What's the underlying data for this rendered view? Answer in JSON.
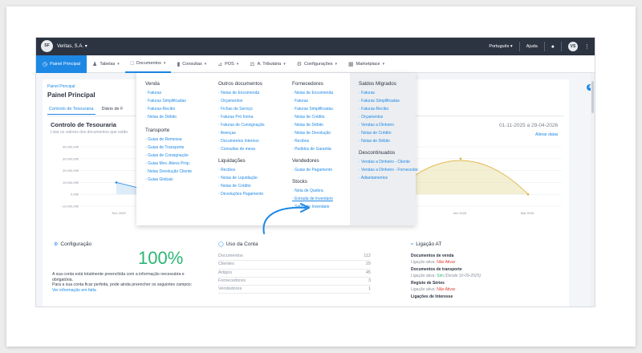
{
  "topbar": {
    "logo_text": "SF",
    "company": "Veritas, S.A.",
    "language": "Português",
    "help": "Ajuda",
    "avatar_text": "VS"
  },
  "navbar": {
    "items": [
      {
        "label": "Painel Principal",
        "icon": "clock-icon"
      },
      {
        "label": "Tabelas",
        "icon": "users-icon"
      },
      {
        "label": "Documentos",
        "icon": "document-icon"
      },
      {
        "label": "Consultas",
        "icon": "bar-chart-icon"
      },
      {
        "label": "POS",
        "icon": "pos-icon"
      },
      {
        "label": "A. Tributária",
        "icon": "balance-icon"
      },
      {
        "label": "Configurações",
        "icon": "gear-icon"
      },
      {
        "label": "Marketplace",
        "icon": "grid-icon"
      }
    ]
  },
  "page": {
    "breadcrumb": "Painel Principal",
    "title": "Painel Principal",
    "tabs": [
      "Controlo de Tesouraria",
      "Diário de F"
    ]
  },
  "chart_data": {
    "type": "area",
    "title": "Controlo de Tesouraria",
    "subtitle": "Lista os valores dos documentos que estão",
    "date_range": "01-11-2025 a 29-04-2026",
    "change_dates": "Alterar datas",
    "ylim": [
      -10000,
      40000
    ],
    "ytick_labels": [
      "40.000,00€",
      "30.000,00€",
      "20.000,00€",
      "10.000,00€",
      "0,00€",
      "−10.000,00€"
    ],
    "xtick_labels": [
      "Nov 2025",
      "Abr 2026",
      "Mai 2026"
    ],
    "series": [
      {
        "values": [
          [
            0,
            10000
          ],
          [
            1,
            0
          ]
        ],
        "color": "#1e88e5"
      },
      {
        "values": [
          [
            0,
            0
          ],
          [
            1,
            30000
          ],
          [
            2,
            0
          ]
        ],
        "color": "#e0b13a"
      }
    ]
  },
  "configuracao": {
    "title": "Configuração",
    "percent": "100%",
    "text1": "A sua conta está totalmente preenchida com a informação necessária e obrigatória.",
    "text2": "Para a sua conta ficar perfeita, pode ainda preencher os seguintes campos:",
    "link": "Ver informação em falta"
  },
  "uso": {
    "title": "Uso da Conta",
    "rows": [
      {
        "label": "Documentos",
        "value": "112"
      },
      {
        "label": "Clientes",
        "value": "29"
      },
      {
        "label": "Artigos",
        "value": "45"
      },
      {
        "label": "Fornecedores",
        "value": "3"
      },
      {
        "label": "Vendedores",
        "value": "1"
      }
    ]
  },
  "ligacao": {
    "title": "Ligação AT",
    "doc_venda": "Documentos de venda",
    "doc_venda_status": "Ligação ativa:",
    "doc_venda_val": "Não",
    "doc_venda_action": "Ativar",
    "doc_transporte": "Documentos de transporte",
    "doc_transporte_status": "Ligação ativa:",
    "doc_transporte_val": "Sim",
    "doc_transporte_since": "(Desde 10-09-2025)",
    "registo": "Registo de Séries",
    "registo_status": "Ligação ativa:",
    "registo_val": "Não",
    "registo_action": "Ativar",
    "interesse": "Ligações de Interesse"
  },
  "dropdown": {
    "venda": {
      "title": "Venda",
      "items": [
        "Faturas",
        "Faturas Simplificadas",
        "Faturas-Recibo",
        "Notas de Débito"
      ]
    },
    "transporte": {
      "title": "Transporte",
      "items": [
        "Guias de Remessa",
        "Guias de Transporte",
        "Guias de Consignação",
        "Guias Mov. Ativos Próp.",
        "Notas Devolução Cliente",
        "Guias Globais"
      ]
    },
    "outros": {
      "title": "Outros documentos",
      "items": [
        "Notas de Encomenda",
        "Orçamentos",
        "Fichas de Serviço",
        "Faturas Pró forma",
        "Faturas de Consignação",
        "Avenças",
        "Documentos Internos",
        "Consultas de mesa"
      ]
    },
    "liquidacoes": {
      "title": "Liquidações",
      "items": [
        "Recibos",
        "Notas de Liquidação",
        "Notas de Crédito",
        "Devoluções Pagamento"
      ]
    },
    "fornecedores": {
      "title": "Fornecedores",
      "items": [
        "Notas de Encomenda",
        "Faturas",
        "Faturas Simplificadas",
        "Notas de Crédito",
        "Notas de Débito",
        "Notas de Devolução",
        "Recibos",
        "Pedidos de Garantia"
      ]
    },
    "vendedores": {
      "title": "Vendedores",
      "items": [
        "Guias de Pagamento"
      ]
    },
    "stocks": {
      "title": "Stocks",
      "items": [
        "Nota de Quebra",
        "Entrada de Inventário",
        "Saída de Inventário"
      ]
    },
    "migrados": {
      "title": "Saldos Migrados",
      "items": [
        "Faturas",
        "Faturas Simplificadas",
        "Faturas-Recibo",
        "Orçamentos",
        "Vendas a Dinheiro",
        "Notas de Crédito",
        "Notas de Débito"
      ]
    },
    "descontinuados": {
      "title": "Descontinuados",
      "items": [
        "Vendas a Dinheiro - Cliente",
        "Vendas a Dinheiro - Fornecedor",
        "Adiantamentos"
      ]
    }
  }
}
